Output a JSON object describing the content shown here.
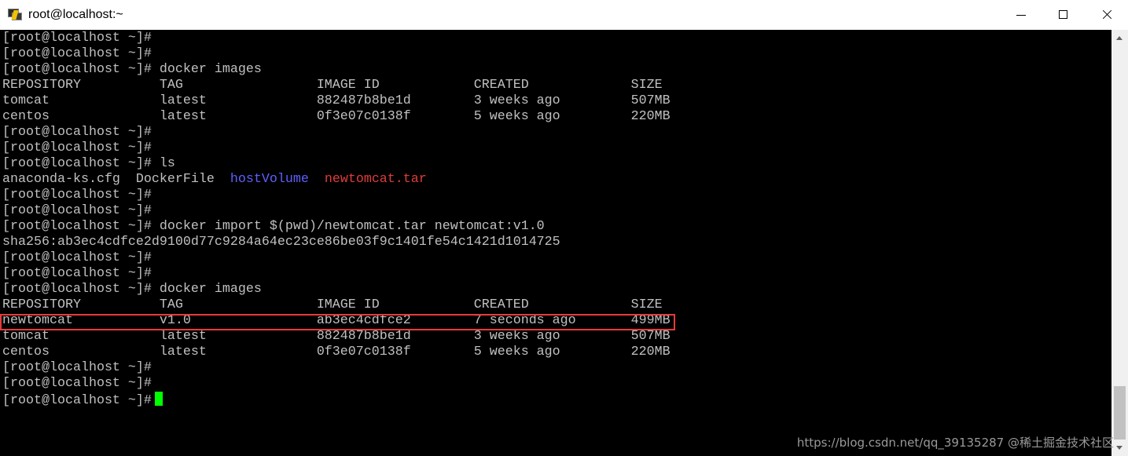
{
  "window": {
    "title": "root@localhost:~"
  },
  "terminal": {
    "lines": [
      [
        {
          "t": "[root@localhost ~]#"
        }
      ],
      [
        {
          "t": "[root@localhost ~]#"
        }
      ],
      [
        {
          "t": "[root@localhost ~]# docker images"
        }
      ],
      [
        {
          "t": "REPOSITORY          TAG                 IMAGE ID            CREATED             SIZE"
        }
      ],
      [
        {
          "t": "tomcat              latest              882487b8be1d        3 weeks ago         507MB"
        }
      ],
      [
        {
          "t": "centos              latest              0f3e07c0138f        5 weeks ago         220MB"
        }
      ],
      [
        {
          "t": "[root@localhost ~]#"
        }
      ],
      [
        {
          "t": "[root@localhost ~]#"
        }
      ],
      [
        {
          "t": "[root@localhost ~]# ls"
        }
      ],
      [
        {
          "t": "anaconda-ks.cfg  DockerFile  "
        },
        {
          "t": "hostVolume",
          "c": "c-blue"
        },
        {
          "t": "  "
        },
        {
          "t": "newtomcat.tar",
          "c": "c-red"
        }
      ],
      [
        {
          "t": "[root@localhost ~]#"
        }
      ],
      [
        {
          "t": "[root@localhost ~]#"
        }
      ],
      [
        {
          "t": "[root@localhost ~]# docker import $(pwd)/newtomcat.tar newtomcat:v1.0"
        }
      ],
      [
        {
          "t": "sha256:ab3ec4cdfce2d9100d77c9284a64ec23ce86be03f9c1401fe54c1421d1014725"
        }
      ],
      [
        {
          "t": "[root@localhost ~]#"
        }
      ],
      [
        {
          "t": "[root@localhost ~]#"
        }
      ],
      [
        {
          "t": "[root@localhost ~]# docker images"
        }
      ],
      [
        {
          "t": "REPOSITORY          TAG                 IMAGE ID            CREATED             SIZE"
        }
      ],
      [
        {
          "t": "newtomcat           v1.0                ab3ec4cdfce2        7 seconds ago       499MB"
        }
      ],
      [
        {
          "t": "tomcat              latest              882487b8be1d        3 weeks ago         507MB"
        }
      ],
      [
        {
          "t": "centos              latest              0f3e07c0138f        5 weeks ago         220MB"
        }
      ],
      [
        {
          "t": "[root@localhost ~]#"
        }
      ],
      [
        {
          "t": "[root@localhost ~]#"
        }
      ],
      [
        {
          "t": "[root@localhost ~]#"
        }
      ]
    ],
    "highlighted_line_index": 18,
    "cursor_color": "#00ff00",
    "colors": {
      "directory": "#5f5fff",
      "archive": "#e03c3c",
      "highlight_box": "#e83a3a"
    }
  },
  "watermark": "https://blog.csdn.net/qq_39135287 @稀土掘金技术社区",
  "icons": [
    "putty-icon",
    "minimize-icon",
    "maximize-icon",
    "close-icon"
  ]
}
